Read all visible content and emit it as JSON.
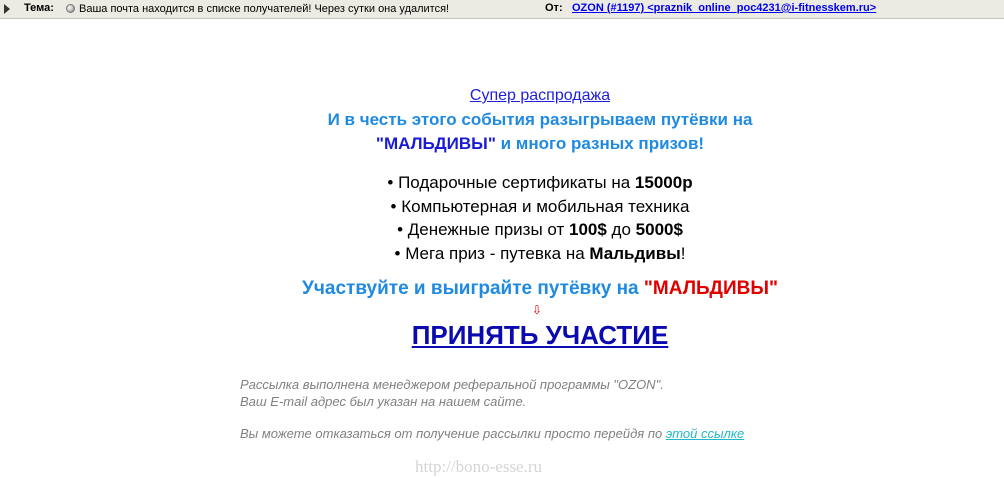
{
  "header": {
    "subject_label": "Тема:",
    "subject_text": "Ваша почта находится в списке получателей! Через сутки она удалится!",
    "from_label": "От:",
    "from_value": "OZON (#1197) <praznik_online_poc4231@i-fitnesskem.ru>"
  },
  "body": {
    "promo_link": "Супер распродажа",
    "headline_part1": "И в честь этого события разыгрываем путёвки на",
    "headline_quote_open": "\"",
    "headline_accent": "МАЛЬДИВЫ",
    "headline_quote_close": "\"",
    "headline_part2": " и много разных призов!",
    "prizes": [
      {
        "text": "• Подарочные сертификаты на ",
        "bold": "15000р",
        "after": ""
      },
      {
        "text": "• Компьютерная и мобильная техника",
        "bold": "",
        "after": ""
      },
      {
        "text": "• Денежные призы от ",
        "bold": "100$",
        "mid": " до ",
        "bold2": "5000$",
        "after": ""
      },
      {
        "text": "• Мега приз - путевка на ",
        "bold": "Мальдивы",
        "after": "!"
      }
    ],
    "cta_text": "Участвуйте и выиграйте путёвку на ",
    "cta_red": "\"МАЛЬДИВЫ\"",
    "arrow": "⇩",
    "join_link": "ПРИНЯТЬ УЧАСТИЕ",
    "footer_line1": "Рассылка выполнена менеджером реферальной программы \"OZON\".",
    "footer_line2": "Ваш E-mail адрес был указан на нашем сайте.",
    "unsubscribe_text": "Вы можете отказаться от получение рассылки просто перейдя по ",
    "unsubscribe_link": "этой ссылке"
  },
  "watermark": "http://bono-esse.ru",
  "colors": {
    "header_bg": "#ecebe3",
    "headline_blue": "#1f8ae0",
    "accent_blue": "#1a1ad6",
    "red": "#e00000",
    "link_cyan": "#20b7c9"
  }
}
